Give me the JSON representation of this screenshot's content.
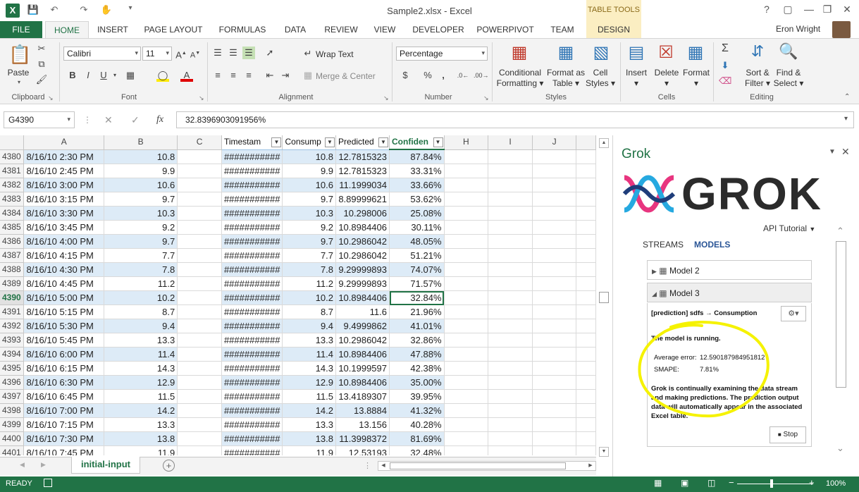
{
  "app": {
    "title": "Sample2.xlsx - Excel",
    "table_tools": "TABLE TOOLS",
    "user": "Eron Wright"
  },
  "tabs": [
    "FILE",
    "HOME",
    "INSERT",
    "PAGE LAYOUT",
    "FORMULAS",
    "DATA",
    "REVIEW",
    "VIEW",
    "DEVELOPER",
    "POWERPIVOT",
    "TEAM",
    "DESIGN"
  ],
  "ribbon": {
    "clipboard": {
      "label": "Clipboard",
      "paste": "Paste"
    },
    "font": {
      "label": "Font",
      "name": "Calibri",
      "size": "11",
      "bold": "B",
      "italic": "I",
      "underline": "U"
    },
    "alignment": {
      "label": "Alignment",
      "wrap": "Wrap Text",
      "merge": "Merge & Center"
    },
    "number": {
      "label": "Number",
      "format": "Percentage",
      "currency": "$",
      "percent": "%",
      "comma": ","
    },
    "styles": {
      "label": "Styles",
      "cond1": "Conditional",
      "cond2": "Formatting",
      "fmt1": "Format as",
      "fmt2": "Table",
      "cell1": "Cell",
      "cell2": "Styles"
    },
    "cells": {
      "label": "Cells",
      "insert": "Insert",
      "delete": "Delete",
      "format": "Format"
    },
    "editing": {
      "label": "Editing",
      "sort1": "Sort &",
      "sort2": "Filter",
      "find1": "Find &",
      "find2": "Select"
    }
  },
  "formula_bar": {
    "name_box": "G4390",
    "fx": "fx",
    "value": "32.8396903091956%"
  },
  "columns": [
    "A",
    "B",
    "C",
    "",
    "",
    "",
    "",
    "H",
    "I",
    "J"
  ],
  "table_headers": [
    "Timestam",
    "Consump",
    "Predicted",
    "Confiden"
  ],
  "rows": [
    {
      "n": "4380",
      "a": "8/16/10 2:30 PM",
      "b": "10.8",
      "d": "###########",
      "e": "10.8",
      "f": "12.7815323",
      "g": "87.84%"
    },
    {
      "n": "4381",
      "a": "8/16/10 2:45 PM",
      "b": "9.9",
      "d": "###########",
      "e": "9.9",
      "f": "12.7815323",
      "g": "33.31%"
    },
    {
      "n": "4382",
      "a": "8/16/10 3:00 PM",
      "b": "10.6",
      "d": "###########",
      "e": "10.6",
      "f": "11.1999034",
      "g": "33.66%"
    },
    {
      "n": "4383",
      "a": "8/16/10 3:15 PM",
      "b": "9.7",
      "d": "###########",
      "e": "9.7",
      "f": "8.89999621",
      "g": "53.62%"
    },
    {
      "n": "4384",
      "a": "8/16/10 3:30 PM",
      "b": "10.3",
      "d": "###########",
      "e": "10.3",
      "f": "10.298006",
      "g": "25.08%"
    },
    {
      "n": "4385",
      "a": "8/16/10 3:45 PM",
      "b": "9.2",
      "d": "###########",
      "e": "9.2",
      "f": "10.8984406",
      "g": "30.11%"
    },
    {
      "n": "4386",
      "a": "8/16/10 4:00 PM",
      "b": "9.7",
      "d": "###########",
      "e": "9.7",
      "f": "10.2986042",
      "g": "48.05%"
    },
    {
      "n": "4387",
      "a": "8/16/10 4:15 PM",
      "b": "7.7",
      "d": "###########",
      "e": "7.7",
      "f": "10.2986042",
      "g": "51.21%"
    },
    {
      "n": "4388",
      "a": "8/16/10 4:30 PM",
      "b": "7.8",
      "d": "###########",
      "e": "7.8",
      "f": "9.29999893",
      "g": "74.07%"
    },
    {
      "n": "4389",
      "a": "8/16/10 4:45 PM",
      "b": "11.2",
      "d": "###########",
      "e": "11.2",
      "f": "9.29999893",
      "g": "71.57%"
    },
    {
      "n": "4390",
      "a": "8/16/10 5:00 PM",
      "b": "10.2",
      "d": "###########",
      "e": "10.2",
      "f": "10.8984406",
      "g": "32.84%"
    },
    {
      "n": "4391",
      "a": "8/16/10 5:15 PM",
      "b": "8.7",
      "d": "###########",
      "e": "8.7",
      "f": "11.6",
      "g": "21.96%"
    },
    {
      "n": "4392",
      "a": "8/16/10 5:30 PM",
      "b": "9.4",
      "d": "###########",
      "e": "9.4",
      "f": "9.4999862",
      "g": "41.01%"
    },
    {
      "n": "4393",
      "a": "8/16/10 5:45 PM",
      "b": "13.3",
      "d": "###########",
      "e": "13.3",
      "f": "10.2986042",
      "g": "32.86%"
    },
    {
      "n": "4394",
      "a": "8/16/10 6:00 PM",
      "b": "11.4",
      "d": "###########",
      "e": "11.4",
      "f": "10.8984406",
      "g": "47.88%"
    },
    {
      "n": "4395",
      "a": "8/16/10 6:15 PM",
      "b": "14.3",
      "d": "###########",
      "e": "14.3",
      "f": "10.1999597",
      "g": "42.38%"
    },
    {
      "n": "4396",
      "a": "8/16/10 6:30 PM",
      "b": "12.9",
      "d": "###########",
      "e": "12.9",
      "f": "10.8984406",
      "g": "35.00%"
    },
    {
      "n": "4397",
      "a": "8/16/10 6:45 PM",
      "b": "11.5",
      "d": "###########",
      "e": "11.5",
      "f": "13.4189307",
      "g": "39.95%"
    },
    {
      "n": "4398",
      "a": "8/16/10 7:00 PM",
      "b": "14.2",
      "d": "###########",
      "e": "14.2",
      "f": "13.8884",
      "g": "41.32%"
    },
    {
      "n": "4399",
      "a": "8/16/10 7:15 PM",
      "b": "13.3",
      "d": "###########",
      "e": "13.3",
      "f": "13.156",
      "g": "40.28%"
    },
    {
      "n": "4400",
      "a": "8/16/10 7:30 PM",
      "b": "13.8",
      "d": "###########",
      "e": "13.8",
      "f": "11.3998372",
      "g": "81.69%"
    },
    {
      "n": "4401",
      "a": "8/16/10 7:45 PM",
      "b": "11.9",
      "d": "###########",
      "e": "11.9",
      "f": "12.53193",
      "g": "32.48%"
    }
  ],
  "sheet_tab": "initial-input",
  "status": {
    "ready": "READY",
    "zoom": "100%"
  },
  "pane": {
    "title": "Grok",
    "logo": "GROK",
    "account": "API Tutorial",
    "streams": "STREAMS",
    "models": "MODELS",
    "model2": "Model 2",
    "model3": "Model 3",
    "prediction": "[prediction] sdfs",
    "arrow": "→",
    "target": "Consumption",
    "running": "The model is running.",
    "avg_label": "Average error:",
    "avg_value": "12.590187984951812",
    "smape_label": "SMAPE:",
    "smape_value": "7.81%",
    "desc": "Grok is continually examining the data stream and making predictions. The prediction output data will automatically appear in the associated Excel table.",
    "stop": "Stop"
  },
  "colors": {
    "excel_green": "#217346",
    "band_blue": "#ddebf7",
    "highlight": "#f5f200",
    "grok_blue": "#2a5596"
  }
}
